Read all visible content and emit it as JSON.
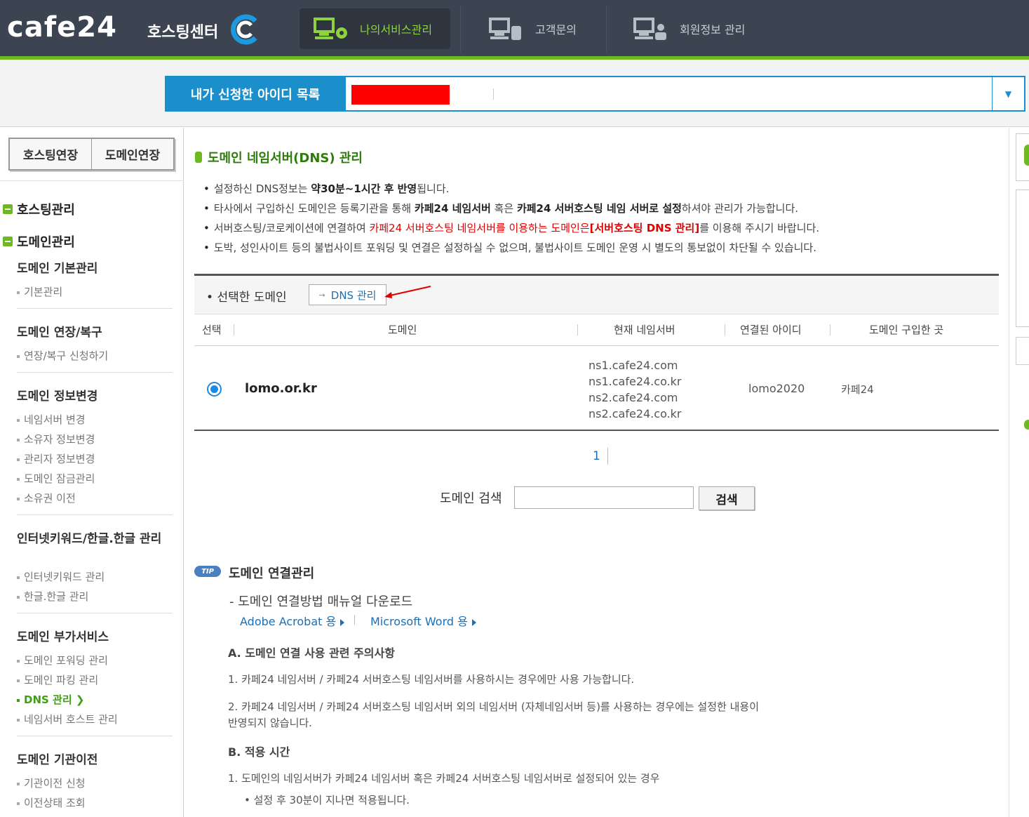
{
  "header": {
    "logo_text": "cafe24",
    "logo_sub": "호스팅센터",
    "nav": [
      {
        "label": "나의서비스관리",
        "icon": "server-gear-icon",
        "active": true
      },
      {
        "label": "고객문의",
        "icon": "server-phone-icon",
        "active": false
      },
      {
        "label": "회원정보 관리",
        "icon": "server-user-icon",
        "active": false
      }
    ]
  },
  "id_selector": {
    "label": "내가 신청한 아이디 목록",
    "value": ""
  },
  "sidebar": {
    "buttons": [
      "호스팅연장",
      "도메인연장"
    ],
    "sections": [
      {
        "title": "호스팅관리"
      },
      {
        "title": "도메인관리"
      }
    ],
    "groups": [
      {
        "title": "도메인 기본관리",
        "items": [
          "기본관리"
        ]
      },
      {
        "title": "도메인 연장/복구",
        "items": [
          "연장/복구 신청하기"
        ]
      },
      {
        "title": "도메인 정보변경",
        "items": [
          "네임서버 변경",
          "소유자 정보변경",
          "관리자 정보변경",
          "도메인 잠금관리",
          "소유권 이전"
        ]
      },
      {
        "title": "인터넷키워드/한글.한글 관리",
        "items": [
          "인터넷키워드 관리",
          "한글.한글 관리"
        ]
      },
      {
        "title": "도메인 부가서비스",
        "items": [
          "도메인 포워딩 관리",
          "도메인 파킹 관리",
          "DNS 관리",
          "네임서버 호스트 관리"
        ]
      },
      {
        "title": "도메인 기관이전",
        "items": [
          "기관이전 신청",
          "이전상태 조회"
        ]
      }
    ],
    "active_item": "DNS 관리"
  },
  "main": {
    "title": "도메인 네임서버(DNS) 관리",
    "notices": {
      "n1": {
        "a": "설정하신 DNS정보는 ",
        "b": "약30분~1시간 후 반영",
        "c": "됩니다."
      },
      "n2": {
        "a": "타사에서 구입하신 도메인은 등록기관을 통해 ",
        "b": "카페24 네임서버",
        "c": " 혹은 ",
        "d": "카페24 서버호스팅 네임 서버로 설정",
        "e": "하셔야 관리가 가능합니다."
      },
      "n3": {
        "a": "서버호스팅/코로케이션에 연결하여 ",
        "r": "카페24 서버호스팅 네임서버를 이용하는 도메인은",
        "rb": "[서버호스팅 DNS 관리]",
        "e": "를 이용해 주시기 바랍니다."
      },
      "n4": "도박, 성인사이트 등의 불법사이트 포워딩 및 연결은 설정하실 수 없으며, 불법사이트 도메인 운영 시 별도의 통보없이 차단될 수 있습니다."
    },
    "selected_domain_label": "선택한 도메인",
    "dns_button": "DNS 관리",
    "table": {
      "headers": [
        "선택",
        "도메인",
        "현재 네임서버",
        "연결된 아이디",
        "도메인 구입한 곳"
      ],
      "row": {
        "domain": "lomo.or.kr",
        "nameservers": [
          "ns1.cafe24.com",
          "ns1.cafe24.co.kr",
          "ns2.cafe24.com",
          "ns2.cafe24.co.kr"
        ],
        "linked_id": "lomo2020",
        "purchased_at": "카페24",
        "selected": true
      }
    },
    "pager": "1",
    "search": {
      "label": "도메인 검색",
      "value": "",
      "button": "검색"
    },
    "tip": {
      "badge": "TIP",
      "title": "도메인 연결관리",
      "manual": "- 도메인 연결방법 매뉴얼 다운로드",
      "links": [
        "Adobe Acrobat 용",
        "Microsoft Word 용"
      ],
      "section_a": "A. 도메인 연결 사용 관련 주의사항",
      "a1": "1. 카페24 네임서버 / 카페24 서버호스팅 네임서버를 사용하시는 경우에만 사용 가능합니다.",
      "a2_line1": "2. 카페24 네임서버 / 카페24 서버호스팅 네임서버 외의 네임서버 (자체네임서버 등)를 사용하는 경우에는 설정한 내용이",
      "a2_line2": "반영되지 않습니다.",
      "section_b": "B. 적용 시간",
      "b1": "1. 도메인의 네임서버가 카페24 네임서버 혹은 카페24 서버호스팅 네임서버로 설정되어 있는 경우",
      "b1_sub": "• 설정 후 30분이 지나면 적용됩니다."
    }
  },
  "colors": {
    "header_bg": "#3b4450",
    "accent_green": "#6cba1f",
    "accent_blue": "#1b8fcc",
    "notice_red": "#e00000"
  }
}
